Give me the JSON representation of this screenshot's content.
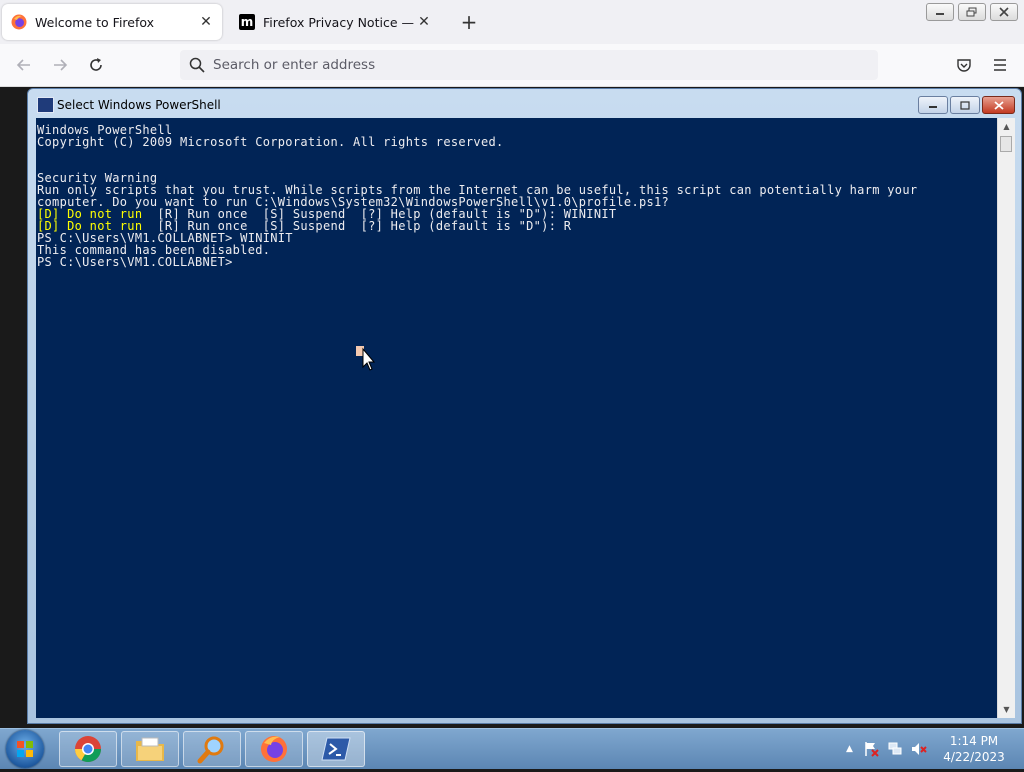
{
  "browser": {
    "tabs": [
      {
        "title": "Welcome to Firefox",
        "active": true,
        "icon": "firefox-icon"
      },
      {
        "title": "Firefox Privacy Notice — Mozilla",
        "active": false,
        "icon": "mozilla-m-icon"
      }
    ],
    "address_placeholder": "Search or enter address"
  },
  "powershell": {
    "title": "Select Windows PowerShell",
    "lines": [
      {
        "text": "Windows PowerShell"
      },
      {
        "text": "Copyright (C) 2009 Microsoft Corporation. All rights reserved."
      },
      {
        "text": ""
      },
      {
        "text": ""
      },
      {
        "text": "Security Warning"
      },
      {
        "text": "Run only scripts that you trust. While scripts from the Internet can be useful, this script can potentially harm your"
      },
      {
        "text": "computer. Do you want to run C:\\Windows\\System32\\WindowsPowerShell\\v1.0\\profile.ps1?"
      },
      {
        "highlight": "[D] Do not run",
        "text": "  [R] Run once  [S] Suspend  [?] Help (default is \"D\"): WININIT"
      },
      {
        "highlight": "[D] Do not run",
        "text": "  [R] Run once  [S] Suspend  [?] Help (default is \"D\"): R"
      },
      {
        "text": "PS C:\\Users\\VM1.COLLABNET> WININIT"
      },
      {
        "text": "This command has been disabled."
      },
      {
        "text": "PS C:\\Users\\VM1.COLLABNET>"
      }
    ],
    "colors": {
      "background": "#012456",
      "text": "#eeedf0",
      "highlight": "#ffff00"
    }
  },
  "taskbar": {
    "apps": [
      "chrome-icon",
      "file-explorer-icon",
      "search-icon",
      "firefox-icon",
      "powershell-icon"
    ],
    "clock": {
      "time": "1:14 PM",
      "date": "4/22/2023"
    }
  }
}
